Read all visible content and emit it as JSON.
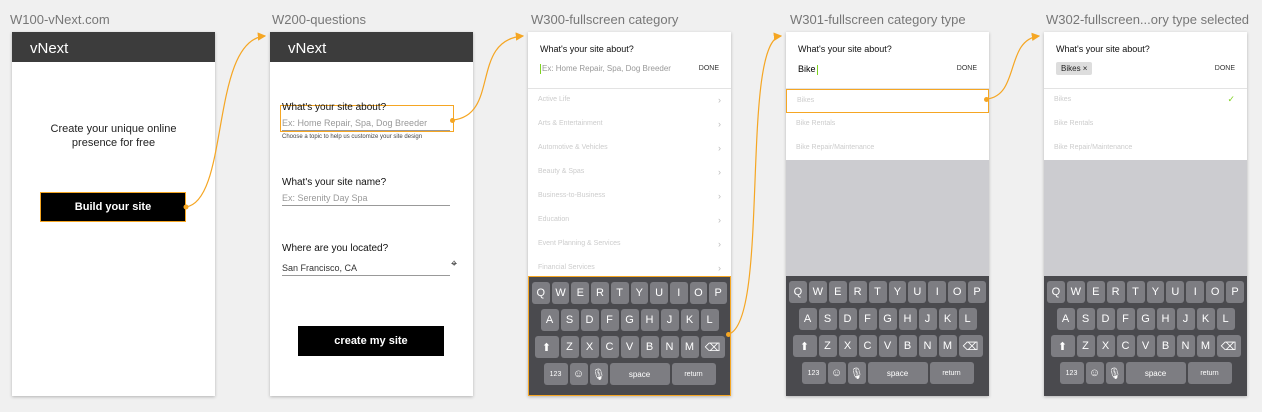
{
  "artboards": {
    "w100": {
      "title": "W100-vNext.com",
      "brand": "vNext",
      "tagline": "Create your unique online presence for free",
      "button": "Build your site"
    },
    "w200": {
      "title": "W200-questions",
      "brand": "vNext",
      "q1": "What's your site about?",
      "q1_placeholder": "Ex: Home Repair, Spa, Dog Breeder",
      "q1_hint": "Choose a topic to help us customize your site design",
      "q2": "What's your site name?",
      "q2_placeholder": "Ex: Serenity Day Spa",
      "q3": "Where are you located?",
      "q3_value": "San Francisco, CA",
      "button": "create my site"
    },
    "w300": {
      "title": "W300-fullscreen category",
      "question": "What's your site about?",
      "placeholder": "Ex: Home Repair, Spa, Dog Breeder",
      "done": "DONE",
      "categories": [
        "Active Life",
        "Arts & Entertainment",
        "Automotive & Vehicles",
        "Beauty & Spas",
        "Business-to-Business",
        "Education",
        "Event Planning & Services",
        "Financial Services"
      ]
    },
    "w301": {
      "title": "W301-fullscreen category type",
      "question": "What's your site about?",
      "typed": "Bike",
      "done": "DONE",
      "items": [
        "Bikes",
        "Bike Rentals",
        "Bike Repair/Maintenance"
      ]
    },
    "w302": {
      "title": "W302-fullscreen...ory type selected",
      "question": "What's your site about?",
      "chip": "Bikes ×",
      "done": "DONE",
      "items": [
        "Bikes",
        "Bike Rentals",
        "Bike Repair/Maintenance"
      ]
    }
  },
  "keyboard": {
    "row1": [
      "Q",
      "W",
      "E",
      "R",
      "T",
      "Y",
      "U",
      "I",
      "O",
      "P"
    ],
    "row2": [
      "A",
      "S",
      "D",
      "F",
      "G",
      "H",
      "J",
      "K",
      "L"
    ],
    "row3": [
      "Z",
      "X",
      "C",
      "V",
      "B",
      "N",
      "M"
    ],
    "shift": "⬆",
    "backspace": "⌫",
    "num": "123",
    "emoji": "☺",
    "mic": "🎙",
    "space": "space",
    "return": "return"
  },
  "icons": {
    "chevron": "›",
    "check": "✓",
    "locate": "⌖"
  },
  "colors": {
    "accent": "#f5a623",
    "navbar": "#3c3c3c",
    "cursor": "#7ed321"
  }
}
